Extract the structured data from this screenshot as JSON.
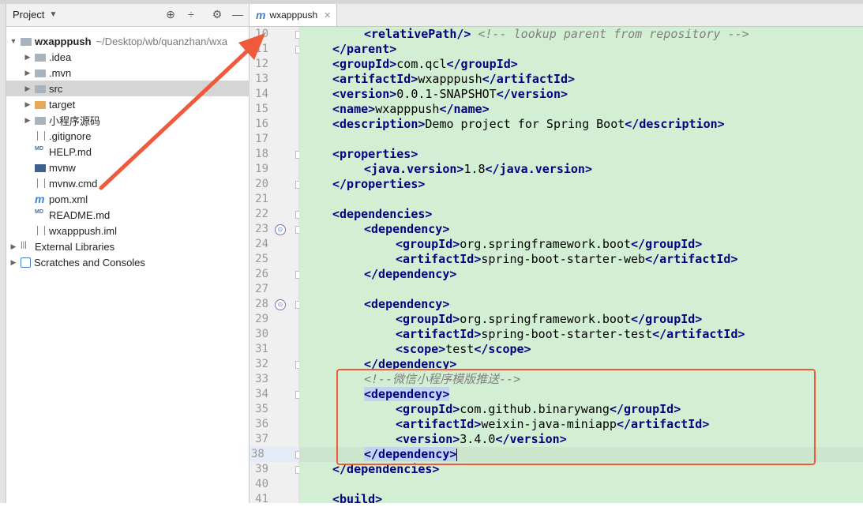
{
  "project_panel": {
    "title": "Project",
    "items": [
      {
        "label": "wxapppush",
        "path": "~/Desktop/wb/quanzhan/wxa",
        "arrow": "▼",
        "icon": "folder-icon",
        "bold": true,
        "indent": 0
      },
      {
        "label": ".idea",
        "arrow": "▶",
        "icon": "folder-icon",
        "indent": 1
      },
      {
        "label": ".mvn",
        "arrow": "▶",
        "icon": "folder-icon",
        "indent": 1
      },
      {
        "label": "src",
        "arrow": "▶",
        "icon": "folder-icon",
        "indent": 1,
        "selected": true
      },
      {
        "label": "target",
        "arrow": "▶",
        "icon": "folder-orange-icon",
        "indent": 1
      },
      {
        "label": "小程序源码",
        "arrow": "▶",
        "icon": "folder-icon",
        "indent": 1
      },
      {
        "label": ".gitignore",
        "arrow": "",
        "icon": "file-icon",
        "indent": 1
      },
      {
        "label": "HELP.md",
        "arrow": "",
        "icon": "md-file-icon",
        "indent": 1
      },
      {
        "label": "mvnw",
        "arrow": "",
        "icon": "script-icon",
        "indent": 1
      },
      {
        "label": "mvnw.cmd",
        "arrow": "",
        "icon": "file-icon",
        "indent": 1
      },
      {
        "label": "pom.xml",
        "arrow": "",
        "icon": "maven-icon",
        "indent": 1
      },
      {
        "label": "README.md",
        "arrow": "",
        "icon": "md-file-icon",
        "indent": 1
      },
      {
        "label": "wxapppush.iml",
        "arrow": "",
        "icon": "iml-file-icon",
        "indent": 1
      },
      {
        "label": "External Libraries",
        "arrow": "▶",
        "icon": "library-icon",
        "indent": 0
      },
      {
        "label": "Scratches and Consoles",
        "arrow": "▶",
        "icon": "scratches-icon",
        "indent": 0
      }
    ]
  },
  "editor": {
    "tab_label": "wxapppush",
    "lines": [
      {
        "n": "10",
        "indent": 2,
        "segs": [
          [
            "tag",
            "<relativePath/>"
          ],
          [
            "t",
            " "
          ],
          [
            "cm",
            "<!-- lookup parent from repository -->"
          ]
        ]
      },
      {
        "n": "11",
        "indent": 1,
        "segs": [
          [
            "tag",
            "</parent>"
          ]
        ]
      },
      {
        "n": "12",
        "indent": 1,
        "segs": [
          [
            "tag",
            "<groupId>"
          ],
          [
            "t",
            "com.qcl"
          ],
          [
            "tag",
            "</groupId>"
          ]
        ]
      },
      {
        "n": "13",
        "indent": 1,
        "segs": [
          [
            "tag",
            "<artifactId>"
          ],
          [
            "t",
            "wxapppush"
          ],
          [
            "tag",
            "</artifactId>"
          ]
        ]
      },
      {
        "n": "14",
        "indent": 1,
        "segs": [
          [
            "tag",
            "<version>"
          ],
          [
            "t",
            "0.0.1-SNAPSHOT"
          ],
          [
            "tag",
            "</version>"
          ]
        ]
      },
      {
        "n": "15",
        "indent": 1,
        "segs": [
          [
            "tag",
            "<name>"
          ],
          [
            "t",
            "wxapppush"
          ],
          [
            "tag",
            "</name>"
          ]
        ]
      },
      {
        "n": "16",
        "indent": 1,
        "segs": [
          [
            "tag",
            "<description>"
          ],
          [
            "t",
            "Demo project for Spring Boot"
          ],
          [
            "tag",
            "</description>"
          ]
        ]
      },
      {
        "n": "17",
        "indent": 0,
        "segs": []
      },
      {
        "n": "18",
        "indent": 1,
        "segs": [
          [
            "tag",
            "<properties>"
          ]
        ]
      },
      {
        "n": "19",
        "indent": 2,
        "segs": [
          [
            "tag",
            "<java.version>"
          ],
          [
            "t",
            "1.8"
          ],
          [
            "tag",
            "</java.version>"
          ]
        ]
      },
      {
        "n": "20",
        "indent": 1,
        "segs": [
          [
            "tag",
            "</properties>"
          ]
        ]
      },
      {
        "n": "21",
        "indent": 0,
        "segs": []
      },
      {
        "n": "22",
        "indent": 1,
        "segs": [
          [
            "tag",
            "<dependencies>"
          ]
        ]
      },
      {
        "n": "23",
        "indent": 2,
        "segs": [
          [
            "tag",
            "<dependency>"
          ]
        ]
      },
      {
        "n": "24",
        "indent": 3,
        "segs": [
          [
            "tag",
            "<groupId>"
          ],
          [
            "t",
            "org.springframework.boot"
          ],
          [
            "tag",
            "</groupId>"
          ]
        ]
      },
      {
        "n": "25",
        "indent": 3,
        "segs": [
          [
            "tag",
            "<artifactId>"
          ],
          [
            "t",
            "spring-boot-starter-web"
          ],
          [
            "tag",
            "</artifactId>"
          ]
        ]
      },
      {
        "n": "26",
        "indent": 2,
        "segs": [
          [
            "tag",
            "</dependency>"
          ]
        ]
      },
      {
        "n": "27",
        "indent": 0,
        "segs": []
      },
      {
        "n": "28",
        "indent": 2,
        "segs": [
          [
            "tag",
            "<dependency>"
          ]
        ]
      },
      {
        "n": "29",
        "indent": 3,
        "segs": [
          [
            "tag",
            "<groupId>"
          ],
          [
            "t",
            "org.springframework.boot"
          ],
          [
            "tag",
            "</groupId>"
          ]
        ]
      },
      {
        "n": "30",
        "indent": 3,
        "segs": [
          [
            "tag",
            "<artifactId>"
          ],
          [
            "t",
            "spring-boot-starter-test"
          ],
          [
            "tag",
            "</artifactId>"
          ]
        ]
      },
      {
        "n": "31",
        "indent": 3,
        "segs": [
          [
            "tag",
            "<scope>"
          ],
          [
            "t",
            "test"
          ],
          [
            "tag",
            "</scope>"
          ]
        ]
      },
      {
        "n": "32",
        "indent": 2,
        "segs": [
          [
            "tag",
            "</dependency>"
          ]
        ]
      },
      {
        "n": "33",
        "indent": 2,
        "segs": [
          [
            "cm",
            "<!--微信小程序模版推送-->"
          ]
        ]
      },
      {
        "n": "34",
        "indent": 2,
        "segs": [
          [
            "taghl",
            "<dependency>"
          ]
        ]
      },
      {
        "n": "35",
        "indent": 3,
        "segs": [
          [
            "tag",
            "<groupId>"
          ],
          [
            "t",
            "com.github.binarywang"
          ],
          [
            "tag",
            "</groupId>"
          ]
        ]
      },
      {
        "n": "36",
        "indent": 3,
        "segs": [
          [
            "tag",
            "<artifactId>"
          ],
          [
            "t",
            "weixin-java-miniapp"
          ],
          [
            "tag",
            "</artifactId>"
          ]
        ]
      },
      {
        "n": "37",
        "indent": 3,
        "segs": [
          [
            "tag",
            "<version>"
          ],
          [
            "t",
            "3.4.0"
          ],
          [
            "tag",
            "</version>"
          ]
        ]
      },
      {
        "n": "38",
        "indent": 2,
        "segs": [
          [
            "taghl",
            "</dependency>"
          ]
        ],
        "current": true
      },
      {
        "n": "39",
        "indent": 1,
        "segs": [
          [
            "tag",
            "</dependencies>"
          ]
        ]
      },
      {
        "n": "40",
        "indent": 0,
        "segs": []
      },
      {
        "n": "41",
        "indent": 1,
        "segs": [
          [
            "tag",
            "<build>"
          ]
        ]
      }
    ]
  },
  "colors": {
    "annotation": "#ef5a3c",
    "code_bg": "#d3efd3",
    "tag": "#000080"
  }
}
